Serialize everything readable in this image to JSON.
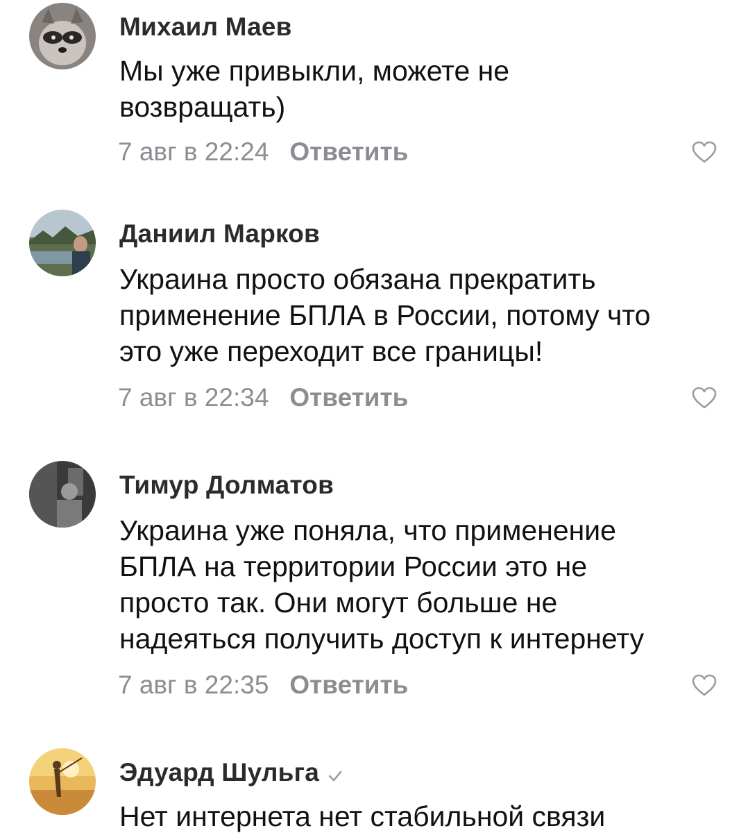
{
  "comments": [
    {
      "author": "Михаил Маев",
      "text": "Мы уже привыкли, можете не\nвозвращать)",
      "time": "7 авг в 22:24",
      "reply_label": "Ответить"
    },
    {
      "author": "Даниил Марков",
      "text": "Украина просто обязана прекратить\nприменение БПЛА в России, потому что\nэто уже переходит все границы!",
      "time": "7 авг в 22:34",
      "reply_label": "Ответить"
    },
    {
      "author": "Тимур Долматов",
      "text": "Украина уже поняла, что применение\nБПЛА на территории России это не\nпросто так. Они могут больше не\nнадеяться получить доступ к интернету",
      "time": "7 авг в 22:35",
      "reply_label": "Ответить"
    },
    {
      "author": "Эдуард Шульга",
      "text": "Нет интернета нет стабильной связи",
      "verified": true
    }
  ],
  "icons": {
    "like": "heart-outline-icon",
    "verified": "checkmark-icon"
  },
  "colors": {
    "author": "#2b2b2b",
    "text": "#111111",
    "meta": "#8b8d92",
    "icon": "#9a9ca1"
  }
}
